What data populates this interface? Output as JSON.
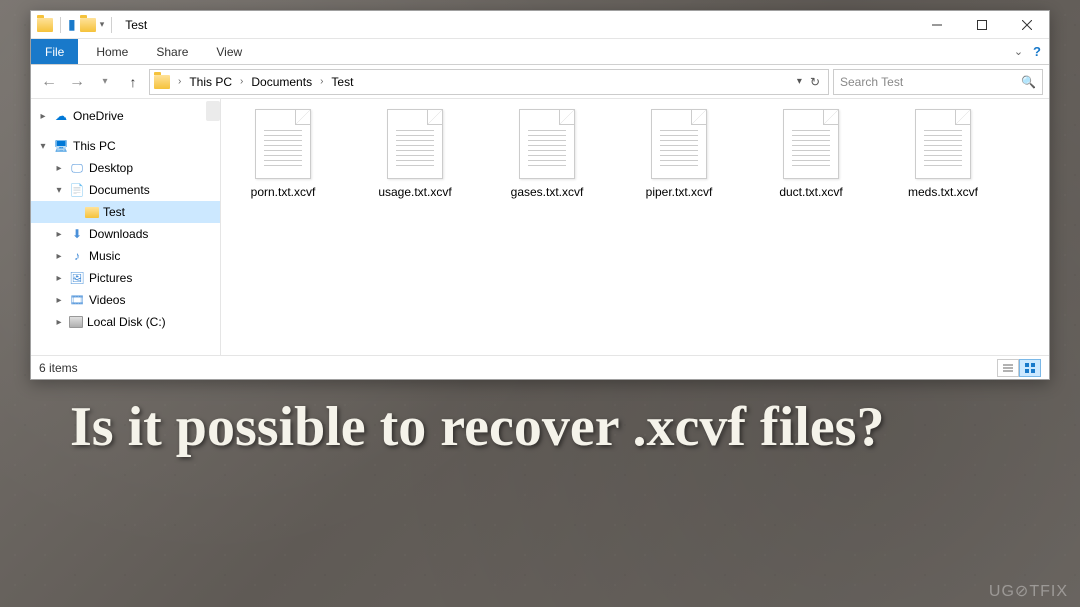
{
  "window": {
    "title": "Test"
  },
  "ribbon": {
    "file": "File",
    "tabs": [
      "Home",
      "Share",
      "View"
    ]
  },
  "breadcrumb": {
    "segments": [
      "This PC",
      "Documents",
      "Test"
    ]
  },
  "search": {
    "placeholder": "Search Test"
  },
  "sidebar": {
    "items": [
      {
        "label": "OneDrive",
        "icon": "onedrive",
        "expander": "▸",
        "indent": 0
      },
      {
        "label": "This PC",
        "icon": "thispc",
        "expander": "▾",
        "indent": 0
      },
      {
        "label": "Desktop",
        "icon": "folder",
        "expander": "▸",
        "indent": 1
      },
      {
        "label": "Documents",
        "icon": "doc",
        "expander": "▾",
        "indent": 1
      },
      {
        "label": "Test",
        "icon": "folder",
        "expander": "",
        "indent": 2,
        "selected": true
      },
      {
        "label": "Downloads",
        "icon": "folder",
        "expander": "▸",
        "indent": 1
      },
      {
        "label": "Music",
        "icon": "folder",
        "expander": "▸",
        "indent": 1
      },
      {
        "label": "Pictures",
        "icon": "folder",
        "expander": "▸",
        "indent": 1
      },
      {
        "label": "Videos",
        "icon": "folder",
        "expander": "▸",
        "indent": 1
      },
      {
        "label": "Local Disk (C:)",
        "icon": "disk",
        "expander": "▸",
        "indent": 1
      }
    ]
  },
  "files": [
    "porn.txt.xcvf",
    "usage.txt.xcvf",
    "gases.txt.xcvf",
    "piper.txt.xcvf",
    "duct.txt.xcvf",
    "meds.txt.xcvf"
  ],
  "statusbar": {
    "item_count": "6 items"
  },
  "caption": "Is it possible to recover .xcvf files?",
  "watermark": "UG⊘TFIX"
}
